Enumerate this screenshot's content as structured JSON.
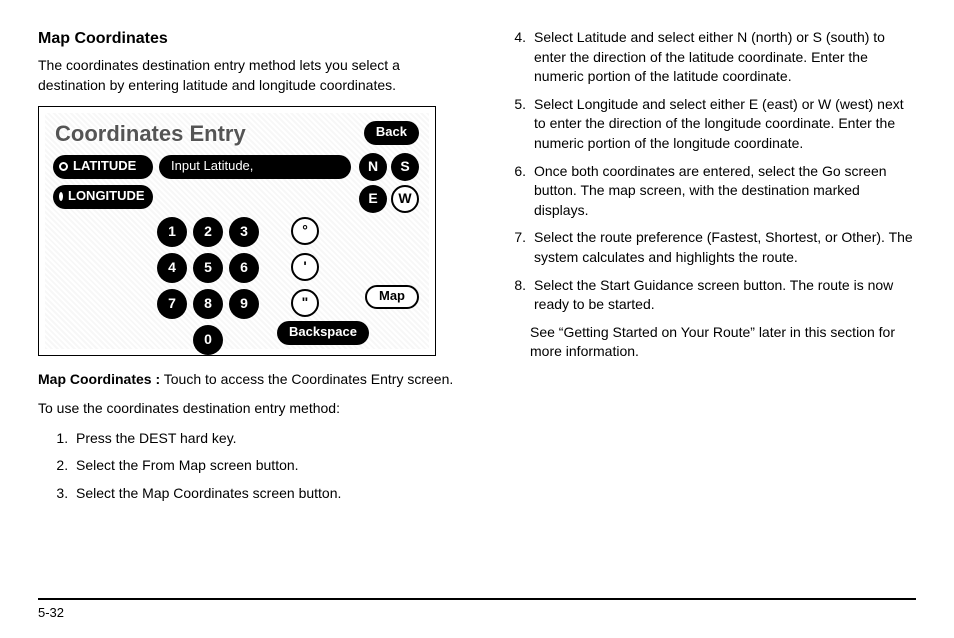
{
  "heading": "Map Coordinates",
  "intro": "The coordinates destination entry method lets you select a destination by entering latitude and longitude coordinates.",
  "screen": {
    "title": "Coordinates Entry",
    "back": "Back",
    "latitude_label": "LATITUDE",
    "longitude_label": "LONGITUDE",
    "input_placeholder": "Input Latitude,",
    "dir_n": "N",
    "dir_s": "S",
    "dir_e": "E",
    "dir_w": "W",
    "keys": {
      "1": "1",
      "2": "2",
      "3": "3",
      "4": "4",
      "5": "5",
      "6": "6",
      "7": "7",
      "8": "8",
      "9": "9",
      "0": "0"
    },
    "punct_deg": "°",
    "punct_min": "'",
    "punct_sec": "\"",
    "map": "Map",
    "backspace": "Backspace"
  },
  "caption_bold": "Map Coordinates :",
  "caption_rest": " Touch to access the Coordinates Entry screen.",
  "lead": "To use the coordinates destination entry method:",
  "steps_left": [
    "Press the DEST hard key.",
    "Select the From Map screen button.",
    "Select the Map Coordinates screen button."
  ],
  "steps_right": [
    {
      "n": "4.",
      "t": "Select Latitude and select either N (north) or S (south) to enter the direction of the latitude coordinate. Enter the numeric portion of the latitude coordinate."
    },
    {
      "n": "5.",
      "t": "Select Longitude and select either E (east) or W (west) next to enter the direction of the longitude coordinate. Enter the numeric portion of the longitude coordinate."
    },
    {
      "n": "6.",
      "t": "Once both coordinates are entered, select the Go screen button. The map screen, with the destination marked displays."
    },
    {
      "n": "7.",
      "t": "Select the route preference (Fastest, Shortest, or Other). The system calculates and highlights the route."
    },
    {
      "n": "8.",
      "t": "Select the Start Guidance screen button. The route is now ready to be started."
    }
  ],
  "closing": "See “Getting Started on Your Route” later in this section for more information.",
  "page_number": "5-32"
}
